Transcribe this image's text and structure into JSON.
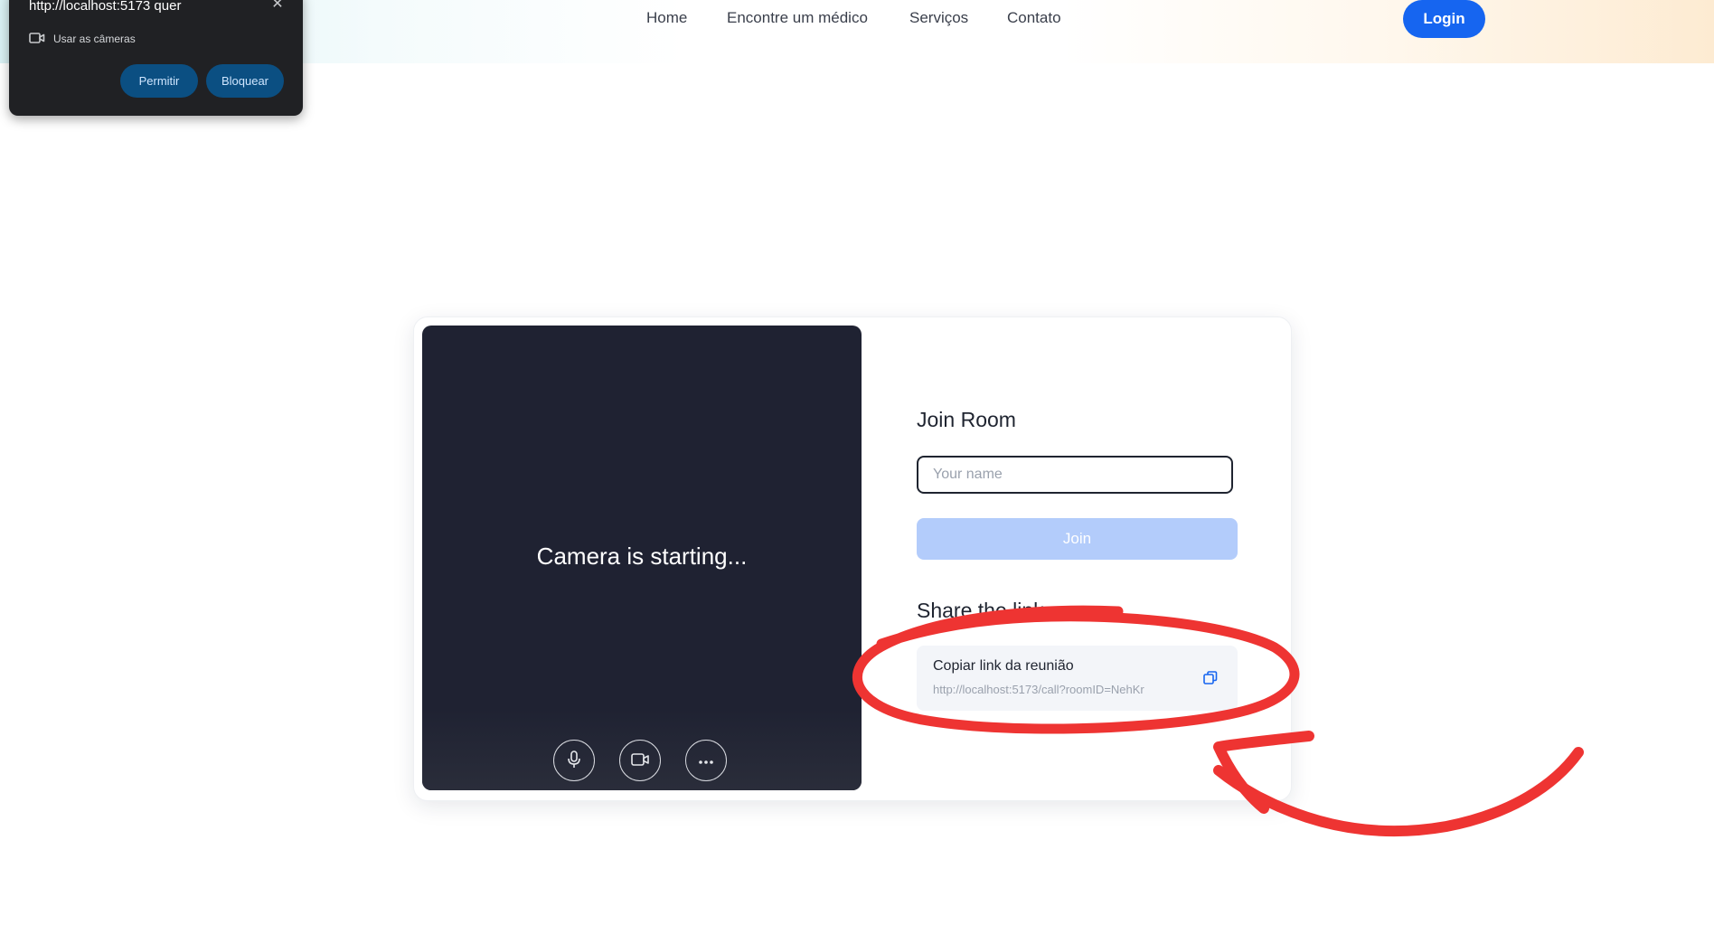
{
  "nav": {
    "links": [
      "Home",
      "Encontre um médico",
      "Serviços",
      "Contato"
    ],
    "login_label": "Login"
  },
  "permission_popup": {
    "title": "http://localhost:5173 quer",
    "permission": "Usar as câmeras",
    "allow_label": "Permitir",
    "block_label": "Bloquear"
  },
  "video": {
    "status": "Camera is starting..."
  },
  "join": {
    "title": "Join Room",
    "name_placeholder": "Your name",
    "name_value": "",
    "button_label": "Join"
  },
  "share": {
    "title": "Share the link",
    "copy_label": "Copiar link da reunião",
    "url": "http://localhost:5173/call?roomID=NehKr"
  },
  "colors": {
    "primary": "#1665f0",
    "join_disabled": "#b3ccfb",
    "video_bg": "#1f2232",
    "annotation": "#ee3432"
  },
  "icons": [
    "microphone-icon",
    "camera-icon",
    "more-icon",
    "copy-icon",
    "video-camera-icon",
    "close-icon"
  ]
}
